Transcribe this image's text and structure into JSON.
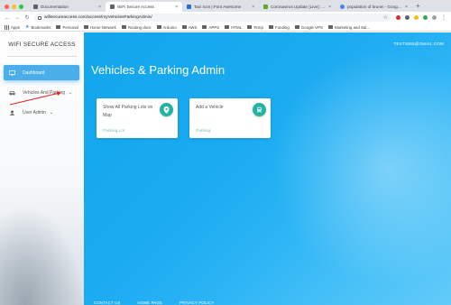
{
  "browser": {
    "tabs": [
      {
        "title": "Documentation",
        "favicon_color": "#5f6368",
        "active": false
      },
      {
        "title": "WiFi Secure Access",
        "favicon_color": "#5f6368",
        "active": true
      },
      {
        "title": "Taxi Icon | Font Awesome",
        "favicon_color": "#2b6fd6",
        "active": false
      },
      {
        "title": "Coronavirus Update (Live): 1,6...",
        "favicon_color": "#5fa52c",
        "active": false
      },
      {
        "title": "population of brunei - Google S...",
        "favicon_color": "#4285f4",
        "active": false
      }
    ],
    "tab_close": "×",
    "new_tab": "+",
    "back": "←",
    "forward": "→",
    "reload": "↻",
    "url": "wifisecureaccess.com/access/myVehiclesParkingAdmin/",
    "star": "☆",
    "bookmarks": [
      {
        "label": "Apps",
        "icon": "apps-grid"
      },
      {
        "label": "Bookmarks",
        "icon": "star"
      },
      {
        "label": "Personal",
        "icon": "folder"
      },
      {
        "label": "Home Network",
        "icon": "folder"
      },
      {
        "label": "Routing docs",
        "icon": "folder"
      },
      {
        "label": "Arduino",
        "icon": "folder"
      },
      {
        "label": "AWS",
        "icon": "folder"
      },
      {
        "label": "APPS",
        "icon": "folder"
      },
      {
        "label": "HTML",
        "icon": "folder"
      },
      {
        "label": "Temp",
        "icon": "folder"
      },
      {
        "label": "Funding",
        "icon": "folder"
      },
      {
        "label": "Google VPS",
        "icon": "folder"
      },
      {
        "label": "Marketing and Sal...",
        "icon": "folder"
      }
    ]
  },
  "sidebar": {
    "brand": "WIFI SECURE ACCESS",
    "items": [
      {
        "label": "Dashboard",
        "icon": "monitor-icon",
        "active": true,
        "caret": ""
      },
      {
        "label": "Vehicles And Parking",
        "icon": "car-icon",
        "active": false,
        "caret": "⌄"
      },
      {
        "label": "User Admin",
        "icon": "user-icon",
        "active": false,
        "caret": "⌄"
      }
    ]
  },
  "header": {
    "user_email": "TEST3065@GMAIL.COM"
  },
  "main": {
    "title": "Vehicles & Parking Admin",
    "cards": [
      {
        "title": "Show All Parking Lots on Map",
        "link": "Parking Lot",
        "icon": "map-marker-icon"
      },
      {
        "title": "Add a Vehicle",
        "link": "Parking",
        "icon": "car-icon"
      }
    ]
  },
  "footer": {
    "links": [
      "CONTACT US",
      "HOME PAGE",
      "PRIVACY POLICY"
    ]
  },
  "colors": {
    "accent": "#49aee9",
    "badge": "#21b3a3",
    "card_link": "#7cc4a8",
    "annotation": "#e32020"
  }
}
